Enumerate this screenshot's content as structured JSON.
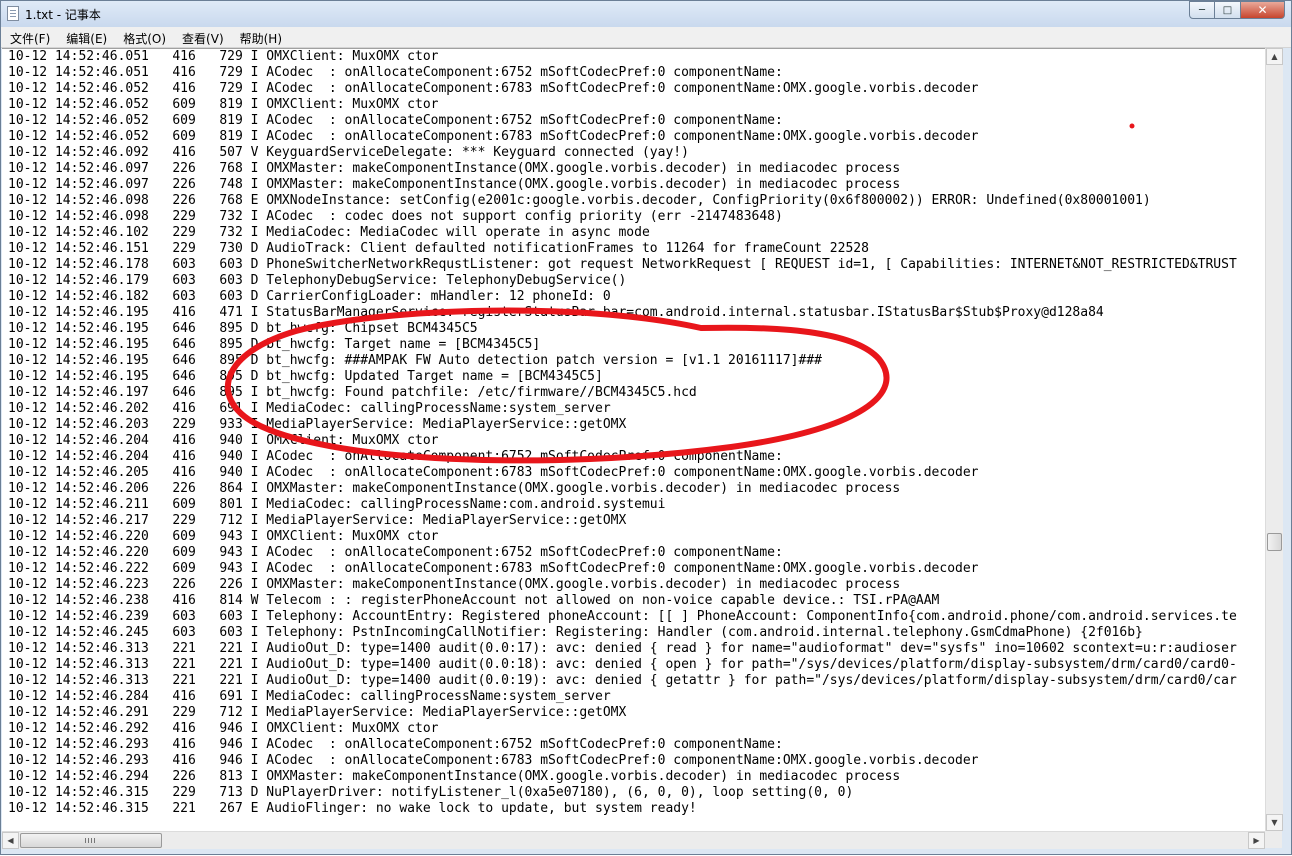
{
  "window": {
    "title": "1.txt - 记事本"
  },
  "icons": {
    "app": "notepad-icon",
    "min": "minimize-icon",
    "max": "maximize-icon",
    "close": "close-icon"
  },
  "caption": {
    "min": "─",
    "max": "□",
    "close": "✕"
  },
  "menu": [
    "文件(F)",
    "编辑(E)",
    "格式(O)",
    "查看(V)",
    "帮助(H)"
  ],
  "colors": {
    "annotation": "#e8161b",
    "close_button": "#c7452d"
  },
  "scroll": {
    "up": "▲",
    "down": "▼",
    "left": "◀",
    "right": "▶"
  },
  "lines": [
    "10-12 14:52:46.051   416   729 I OMXClient: MuxOMX ctor",
    "10-12 14:52:46.051   416   729 I ACodec  : onAllocateComponent:6752 mSoftCodecPref:0 componentName:",
    "10-12 14:52:46.052   416   729 I ACodec  : onAllocateComponent:6783 mSoftCodecPref:0 componentName:OMX.google.vorbis.decoder",
    "10-12 14:52:46.052   609   819 I OMXClient: MuxOMX ctor",
    "10-12 14:52:46.052   609   819 I ACodec  : onAllocateComponent:6752 mSoftCodecPref:0 componentName:",
    "10-12 14:52:46.052   609   819 I ACodec  : onAllocateComponent:6783 mSoftCodecPref:0 componentName:OMX.google.vorbis.decoder",
    "10-12 14:52:46.092   416   507 V KeyguardServiceDelegate: *** Keyguard connected (yay!)",
    "10-12 14:52:46.097   226   768 I OMXMaster: makeComponentInstance(OMX.google.vorbis.decoder) in mediacodec process",
    "10-12 14:52:46.097   226   748 I OMXMaster: makeComponentInstance(OMX.google.vorbis.decoder) in mediacodec process",
    "10-12 14:52:46.098   226   768 E OMXNodeInstance: setConfig(e2001c:google.vorbis.decoder, ConfigPriority(0x6f800002)) ERROR: Undefined(0x80001001)",
    "10-12 14:52:46.098   229   732 I ACodec  : codec does not support config priority (err -2147483648)",
    "10-12 14:52:46.102   229   732 I MediaCodec: MediaCodec will operate in async mode",
    "10-12 14:52:46.151   229   730 D AudioTrack: Client defaulted notificationFrames to 11264 for frameCount 22528",
    "10-12 14:52:46.178   603   603 D PhoneSwitcherNetworkRequstListener: got request NetworkRequest [ REQUEST id=1, [ Capabilities: INTERNET&NOT_RESTRICTED&TRUST",
    "10-12 14:52:46.179   603   603 D TelephonyDebugService: TelephonyDebugService()",
    "10-12 14:52:46.182   603   603 D CarrierConfigLoader: mHandler: 12 phoneId: 0",
    "10-12 14:52:46.195   416   471 I StatusBarManagerService: registerStatusBar bar=com.android.internal.statusbar.IStatusBar$Stub$Proxy@d128a84",
    "10-12 14:52:46.195   646   895 D bt_hwcfg: Chipset BCM4345C5",
    "10-12 14:52:46.195   646   895 D bt_hwcfg: Target name = [BCM4345C5]",
    "10-12 14:52:46.195   646   895 D bt_hwcfg: ###AMPAK FW Auto detection patch version = [v1.1 20161117]###",
    "10-12 14:52:46.195   646   895 D bt_hwcfg: Updated Target name = [BCM4345C5]",
    "10-12 14:52:46.197   646   895 I bt_hwcfg: Found patchfile: /etc/firmware//BCM4345C5.hcd",
    "10-12 14:52:46.202   416   691 I MediaCodec: callingProcessName:system_server",
    "10-12 14:52:46.203   229   933 I MediaPlayerService: MediaPlayerService::getOMX",
    "10-12 14:52:46.204   416   940 I OMXClient: MuxOMX ctor",
    "10-12 14:52:46.204   416   940 I ACodec  : onAllocateComponent:6752 mSoftCodecPref:0 componentName:",
    "10-12 14:52:46.205   416   940 I ACodec  : onAllocateComponent:6783 mSoftCodecPref:0 componentName:OMX.google.vorbis.decoder",
    "10-12 14:52:46.206   226   864 I OMXMaster: makeComponentInstance(OMX.google.vorbis.decoder) in mediacodec process",
    "10-12 14:52:46.211   609   801 I MediaCodec: callingProcessName:com.android.systemui",
    "10-12 14:52:46.217   229   712 I MediaPlayerService: MediaPlayerService::getOMX",
    "10-12 14:52:46.220   609   943 I OMXClient: MuxOMX ctor",
    "10-12 14:52:46.220   609   943 I ACodec  : onAllocateComponent:6752 mSoftCodecPref:0 componentName:",
    "10-12 14:52:46.222   609   943 I ACodec  : onAllocateComponent:6783 mSoftCodecPref:0 componentName:OMX.google.vorbis.decoder",
    "10-12 14:52:46.223   226   226 I OMXMaster: makeComponentInstance(OMX.google.vorbis.decoder) in mediacodec process",
    "10-12 14:52:46.238   416   814 W Telecom : : registerPhoneAccount not allowed on non-voice capable device.: TSI.rPA@AAM",
    "10-12 14:52:46.239   603   603 I Telephony: AccountEntry: Registered phoneAccount: [[ ] PhoneAccount: ComponentInfo{com.android.phone/com.android.services.te",
    "10-12 14:52:46.245   603   603 I Telephony: PstnIncomingCallNotifier: Registering: Handler (com.android.internal.telephony.GsmCdmaPhone) {2f016b}",
    "10-12 14:52:46.313   221   221 I AudioOut_D: type=1400 audit(0.0:17): avc: denied { read } for name=\"audioformat\" dev=\"sysfs\" ino=10602 scontext=u:r:audioser",
    "10-12 14:52:46.313   221   221 I AudioOut_D: type=1400 audit(0.0:18): avc: denied { open } for path=\"/sys/devices/platform/display-subsystem/drm/card0/card0-",
    "10-12 14:52:46.313   221   221 I AudioOut_D: type=1400 audit(0.0:19): avc: denied { getattr } for path=\"/sys/devices/platform/display-subsystem/drm/card0/car",
    "10-12 14:52:46.284   416   691 I MediaCodec: callingProcessName:system_server",
    "10-12 14:52:46.291   229   712 I MediaPlayerService: MediaPlayerService::getOMX",
    "10-12 14:52:46.292   416   946 I OMXClient: MuxOMX ctor",
    "10-12 14:52:46.293   416   946 I ACodec  : onAllocateComponent:6752 mSoftCodecPref:0 componentName:",
    "10-12 14:52:46.293   416   946 I ACodec  : onAllocateComponent:6783 mSoftCodecPref:0 componentName:OMX.google.vorbis.decoder",
    "10-12 14:52:46.294   226   813 I OMXMaster: makeComponentInstance(OMX.google.vorbis.decoder) in mediacodec process",
    "10-12 14:52:46.315   229   713 D NuPlayerDriver: notifyListener_l(0xa5e07180), (6, 0, 0), loop setting(0, 0)",
    "10-12 14:52:46.315   221   267 E AudioFlinger: no wake lock to update, but system ready!"
  ]
}
